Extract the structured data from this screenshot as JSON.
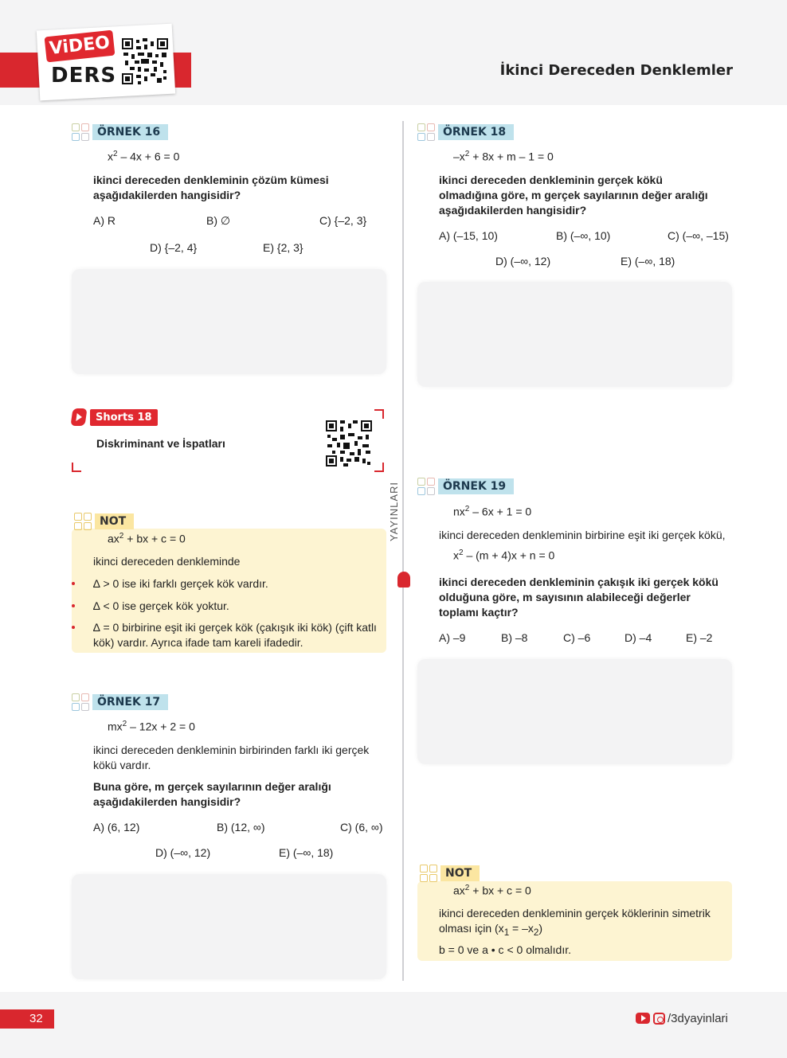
{
  "header": {
    "video_badge": "ViDEO",
    "ders_label": "DERS",
    "chapter_title": "İkinci Dereceden Denklemler"
  },
  "side_label": "YAYINLARI",
  "ornek16": {
    "tag": "ÖRNEK 16",
    "eq_a": "x",
    "eq_a_sup": "2",
    "eq_b": " – 4x + 6 = 0",
    "q1": "ikinci dereceden denkleminin çözüm kümesi",
    "q2": "aşağıdakilerden hangisidir?",
    "options": [
      "A) R",
      "B) ∅",
      "C) {–2, 3}",
      "D) {–2, 4}",
      "E) {2, 3}"
    ]
  },
  "shorts": {
    "badge": "Shorts 18",
    "title": "Diskriminant ve İspatları"
  },
  "note1": {
    "tag": "NOT",
    "eq_a": "ax",
    "eq_a_sup": "2",
    "eq_b": " + bx + c = 0",
    "intro": "ikinci dereceden denkleminde",
    "b1": "∆ > 0 ise iki farklı gerçek kök vardır.",
    "b2": "∆ < 0 ise gerçek kök yoktur.",
    "b3a": "∆ = 0 birbirine eşit iki gerçek kök (çakışık iki kök) (çift katlı",
    "b3b": "kök) vardır. Ayrıca ifade tam kareli ifadedir."
  },
  "ornek17": {
    "tag": "ÖRNEK 17",
    "eq_a": "mx",
    "eq_a_sup": "2",
    "eq_b": " – 12x + 2 = 0",
    "t1": "ikinci dereceden denkleminin birbirinden farklı iki gerçek",
    "t2": "kökü vardır.",
    "q1": "Buna göre, m gerçek sayılarının değer aralığı",
    "q2": "aşağıdakilerden hangisidir?",
    "options": [
      "A) (6, 12)",
      "B) (12, ∞)",
      "C) (6, ∞)",
      "D) (–∞, 12)",
      "E) (–∞, 18)"
    ]
  },
  "ornek18": {
    "tag": "ÖRNEK 18",
    "eq_a": "–x",
    "eq_a_sup": "2",
    "eq_b": " + 8x + m – 1 = 0",
    "q1": "ikinci dereceden denkleminin gerçek kökü",
    "q2": "olmadığına göre, m gerçek sayılarının değer aralığı",
    "q3": "aşağıdakilerden hangisidir?",
    "options": [
      "A) (–15, 10)",
      "B) (–∞, 10)",
      "C) (–∞, –15)",
      "D) (–∞, 12)",
      "E) (–∞, 18)"
    ]
  },
  "ornek19": {
    "tag": "ÖRNEK 19",
    "eq_a": "nx",
    "eq_a_sup": "2",
    "eq_b": " – 6x + 1 = 0",
    "t1": "ikinci dereceden denkleminin birbirine eşit iki gerçek kökü,",
    "eq2_a": "x",
    "eq2_a_sup": "2",
    "eq2_b": " – (m + 4)x + n = 0",
    "q1": "ikinci dereceden denkleminin çakışık iki gerçek kökü",
    "q2": "olduğuna göre, m sayısının alabileceği değerler",
    "q3": "toplamı kaçtır?",
    "options": [
      "A) –9",
      "B) –8",
      "C) –6",
      "D) –4",
      "E) –2"
    ]
  },
  "note2": {
    "tag": "NOT",
    "eq_a": "ax",
    "eq_a_sup": "2",
    "eq_b": " + bx + c = 0",
    "t1": "ikinci dereceden denkleminin gerçek köklerinin simetrik",
    "t2_a": "olması için (x",
    "t2_sub1": "1",
    "t2_b": " = –x",
    "t2_sub2": "2",
    "t2_c": ")",
    "t3": "b = 0 ve a • c < 0 olmalıdır."
  },
  "footer": {
    "page_number": "32",
    "social_handle": "/3dyayinlari"
  }
}
